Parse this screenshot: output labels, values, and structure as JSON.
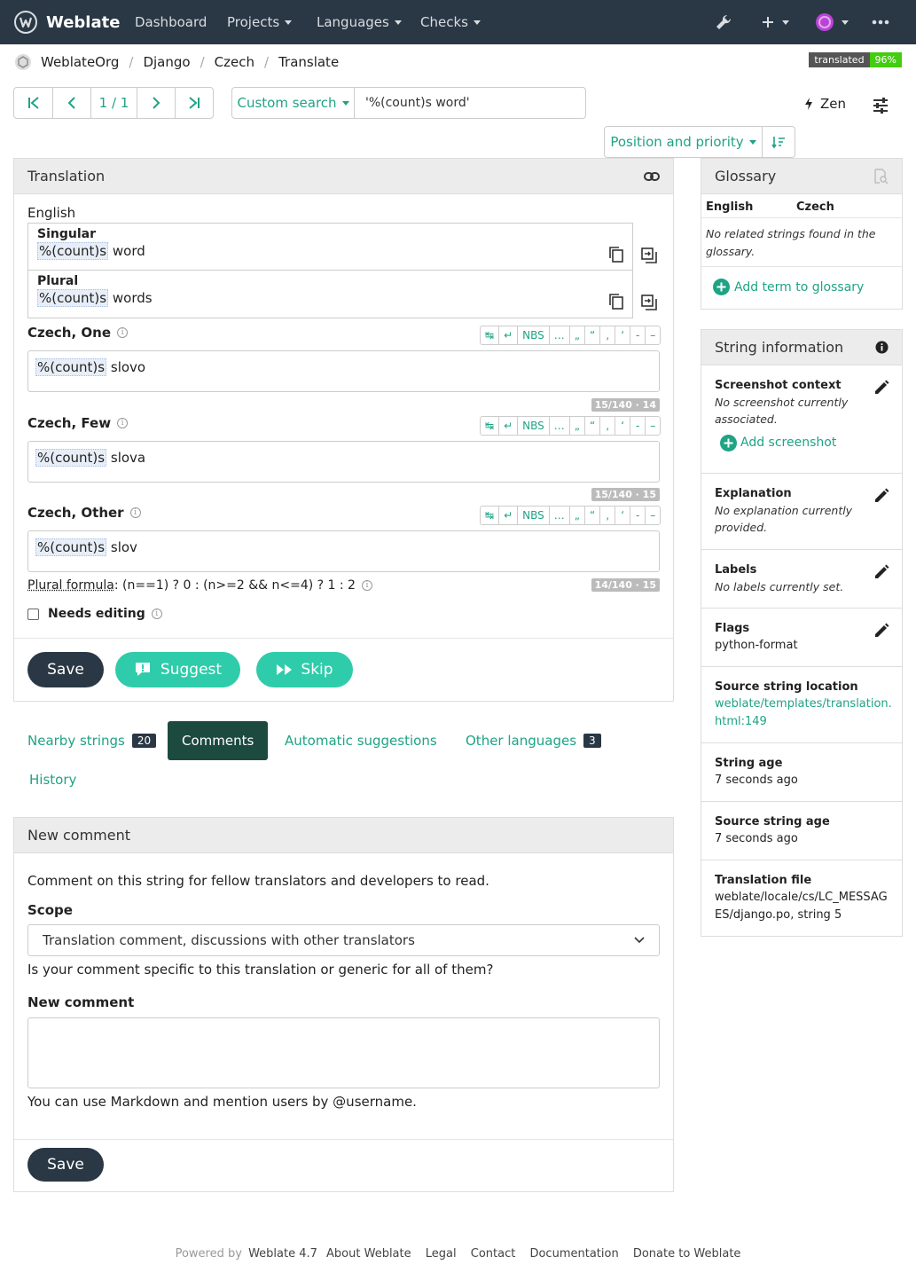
{
  "navbar": {
    "brand": "Weblate",
    "items": [
      "Dashboard",
      "Projects",
      "Languages",
      "Checks"
    ]
  },
  "breadcrumb": [
    "WeblateOrg",
    "Django",
    "Czech",
    "Translate"
  ],
  "status_badge": {
    "label": "translated",
    "value": "96%"
  },
  "pager": {
    "position": "1 / 1"
  },
  "search": {
    "button_label": "Custom search",
    "query": "'%(count)s word'"
  },
  "zen_label": "Zen",
  "sort": {
    "label": "Position and priority"
  },
  "translation": {
    "title": "Translation",
    "source_language": "English",
    "source": [
      {
        "label": "Singular",
        "placeholder": "%(count)s",
        "text": "word"
      },
      {
        "label": "Plural",
        "placeholder": "%(count)s",
        "text": "words"
      }
    ],
    "special_chars": [
      "↹",
      "↵",
      "NBS",
      "…",
      "„",
      "“",
      "‚",
      "‘",
      "-",
      "–"
    ],
    "plurals": [
      {
        "label": "Czech, One",
        "placeholder": "%(count)s",
        "text": "slovo",
        "counter": "15/140 · 14"
      },
      {
        "label": "Czech, Few",
        "placeholder": "%(count)s",
        "text": "slova",
        "counter": "15/140 · 15"
      },
      {
        "label": "Czech, Other",
        "placeholder": "%(count)s",
        "text": "slov",
        "counter": "14/140 · 15"
      }
    ],
    "plural_formula_label": "Plural formula",
    "plural_formula": ": (n==1) ? 0 : (n>=2 && n<=4) ? 1 : 2",
    "needs_editing": "Needs editing",
    "buttons": {
      "save": "Save",
      "suggest": "Suggest",
      "skip": "Skip"
    }
  },
  "tabs": [
    {
      "label": "Nearby strings",
      "count": "20"
    },
    {
      "label": "Comments"
    },
    {
      "label": "Automatic suggestions"
    },
    {
      "label": "Other languages",
      "count": "3"
    },
    {
      "label": "History"
    }
  ],
  "comment": {
    "title": "New comment",
    "intro": "Comment on this string for fellow translators and developers to read.",
    "scope_label": "Scope",
    "scope_value": "Translation comment, discussions with other translators",
    "scope_help": "Is your comment specific to this translation or generic for all of them?",
    "new_comment_label": "New comment",
    "markdown_help": "You can use Markdown and mention users by @username.",
    "save": "Save"
  },
  "glossary": {
    "title": "Glossary",
    "col_source": "English",
    "col_target": "Czech",
    "empty": "No related strings found in the glossary.",
    "add_term": "Add term to glossary"
  },
  "string_info": {
    "title": "String information",
    "screenshot_title": "Screenshot context",
    "screenshot_text": "No screenshot currently associated.",
    "add_screenshot": "Add screenshot",
    "explanation_title": "Explanation",
    "explanation_text": "No explanation currently provided.",
    "labels_title": "Labels",
    "labels_text": "No labels currently set.",
    "flags_title": "Flags",
    "flags_text": "python-format",
    "location_title": "Source string location",
    "location_link": "weblate/templates/translation.html:149",
    "age_title": "String age",
    "age_text": "7 seconds ago",
    "source_age_title": "Source string age",
    "source_age_text": "7 seconds ago",
    "file_title": "Translation file",
    "file_text": "weblate/locale/cs/LC_MESSAGES/django.po, string 5"
  },
  "footer": {
    "powered_by": "Powered by",
    "version_link": "Weblate 4.7",
    "links": [
      "About Weblate",
      "Legal",
      "Contact",
      "Documentation",
      "Donate to Weblate"
    ]
  }
}
